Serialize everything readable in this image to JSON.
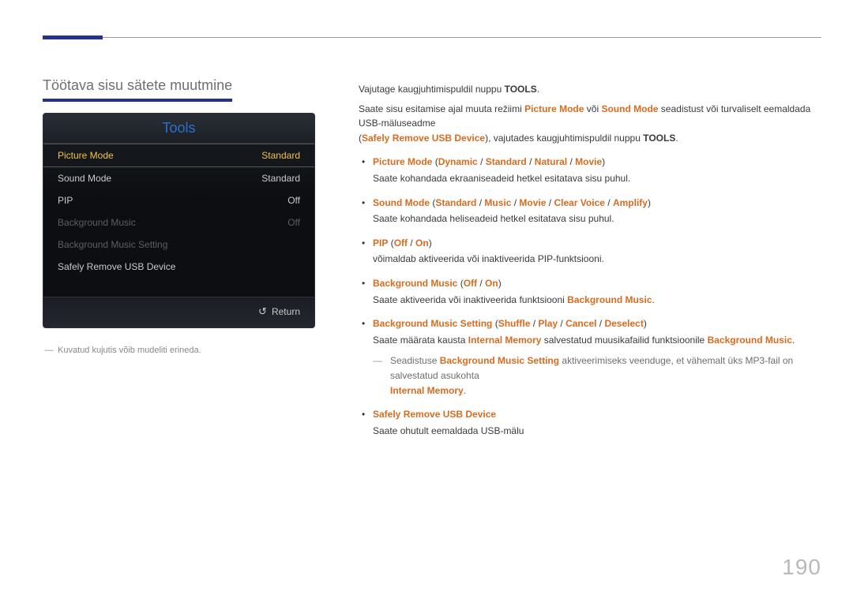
{
  "page_number": "190",
  "section_title": "Töötava sisu sätete muutmine",
  "panel": {
    "title": "Tools",
    "rows": [
      {
        "label": "Picture Mode",
        "value": "Standard",
        "state": "selected"
      },
      {
        "label": "Sound Mode",
        "value": "Standard",
        "state": "normal"
      },
      {
        "label": "PIP",
        "value": "Off",
        "state": "normal"
      },
      {
        "label": "Background Music",
        "value": "Off",
        "state": "disabled"
      },
      {
        "label": "Background Music Setting",
        "value": "",
        "state": "disabled"
      },
      {
        "label": "Safely Remove USB Device",
        "value": "",
        "state": "normal"
      }
    ],
    "return_label": "Return"
  },
  "caption": "Kuvatud kujutis võib mudeliti erineda.",
  "body": {
    "intro1_a": "Vajutage kaugjuhtimispuldil nuppu ",
    "intro1_b": "TOOLS",
    "intro1_c": ".",
    "intro2_a": "Saate sisu esitamise ajal muuta režiimi ",
    "pm": "Picture Mode",
    "or": " või ",
    "sm": "Sound Mode",
    "intro2_b": " seadistust või turvaliselt eemaldada USB-mäluseadme",
    "intro2_c": "(",
    "sru": "Safely Remove USB Device",
    "intro2_d": "), vajutades kaugjuhtimispuldil nuppu ",
    "intro2_e": "TOOLS",
    "intro2_f": ".",
    "items": [
      {
        "head_parts": [
          "Picture Mode",
          " (",
          "Dynamic",
          " / ",
          "Standard",
          " / ",
          "Natural",
          " / ",
          "Movie",
          ")"
        ],
        "desc": "Saate kohandada ekraaniseadeid hetkel esitatava sisu puhul."
      },
      {
        "head_parts": [
          "Sound Mode",
          " (",
          "Standard",
          " / ",
          "Music",
          " / ",
          "Movie",
          " / ",
          "Clear Voice",
          " / ",
          "Amplify",
          ")"
        ],
        "desc": "Saate kohandada heliseadeid hetkel esitatava sisu puhul."
      },
      {
        "head_parts": [
          "PIP",
          " (",
          "Off",
          " / ",
          "On",
          ")"
        ],
        "desc": "võimaldab aktiveerida või inaktiveerida PIP-funktsiooni."
      },
      {
        "head_parts": [
          "Background Music",
          " (",
          "Off",
          " / ",
          "On",
          ")"
        ],
        "desc_a": "Saate aktiveerida või inaktiveerida funktsiooni ",
        "desc_b": "Background Music",
        "desc_c": "."
      },
      {
        "head_parts": [
          "Background Music Setting",
          " (",
          "Shuffle",
          " / ",
          "Play",
          " / ",
          "Cancel",
          " / ",
          "Deselect",
          ")"
        ],
        "desc_a": "Saate määrata kausta ",
        "im": "Internal Memory",
        "desc_b": " salvestatud muusikafailid funktsioonile ",
        "bm": "Background Music",
        "desc_c": ".",
        "note_a": "Seadistuse ",
        "note_b": "Background Music Setting",
        "note_c": " aktiveerimiseks veenduge, et vähemalt üks MP3-fail on salvestatud asukohta ",
        "note_d": "Internal Memory",
        "note_e": "."
      },
      {
        "head_parts": [
          "Safely Remove USB Device"
        ],
        "desc": "Saate ohutult eemaldada USB-mälu"
      }
    ]
  }
}
